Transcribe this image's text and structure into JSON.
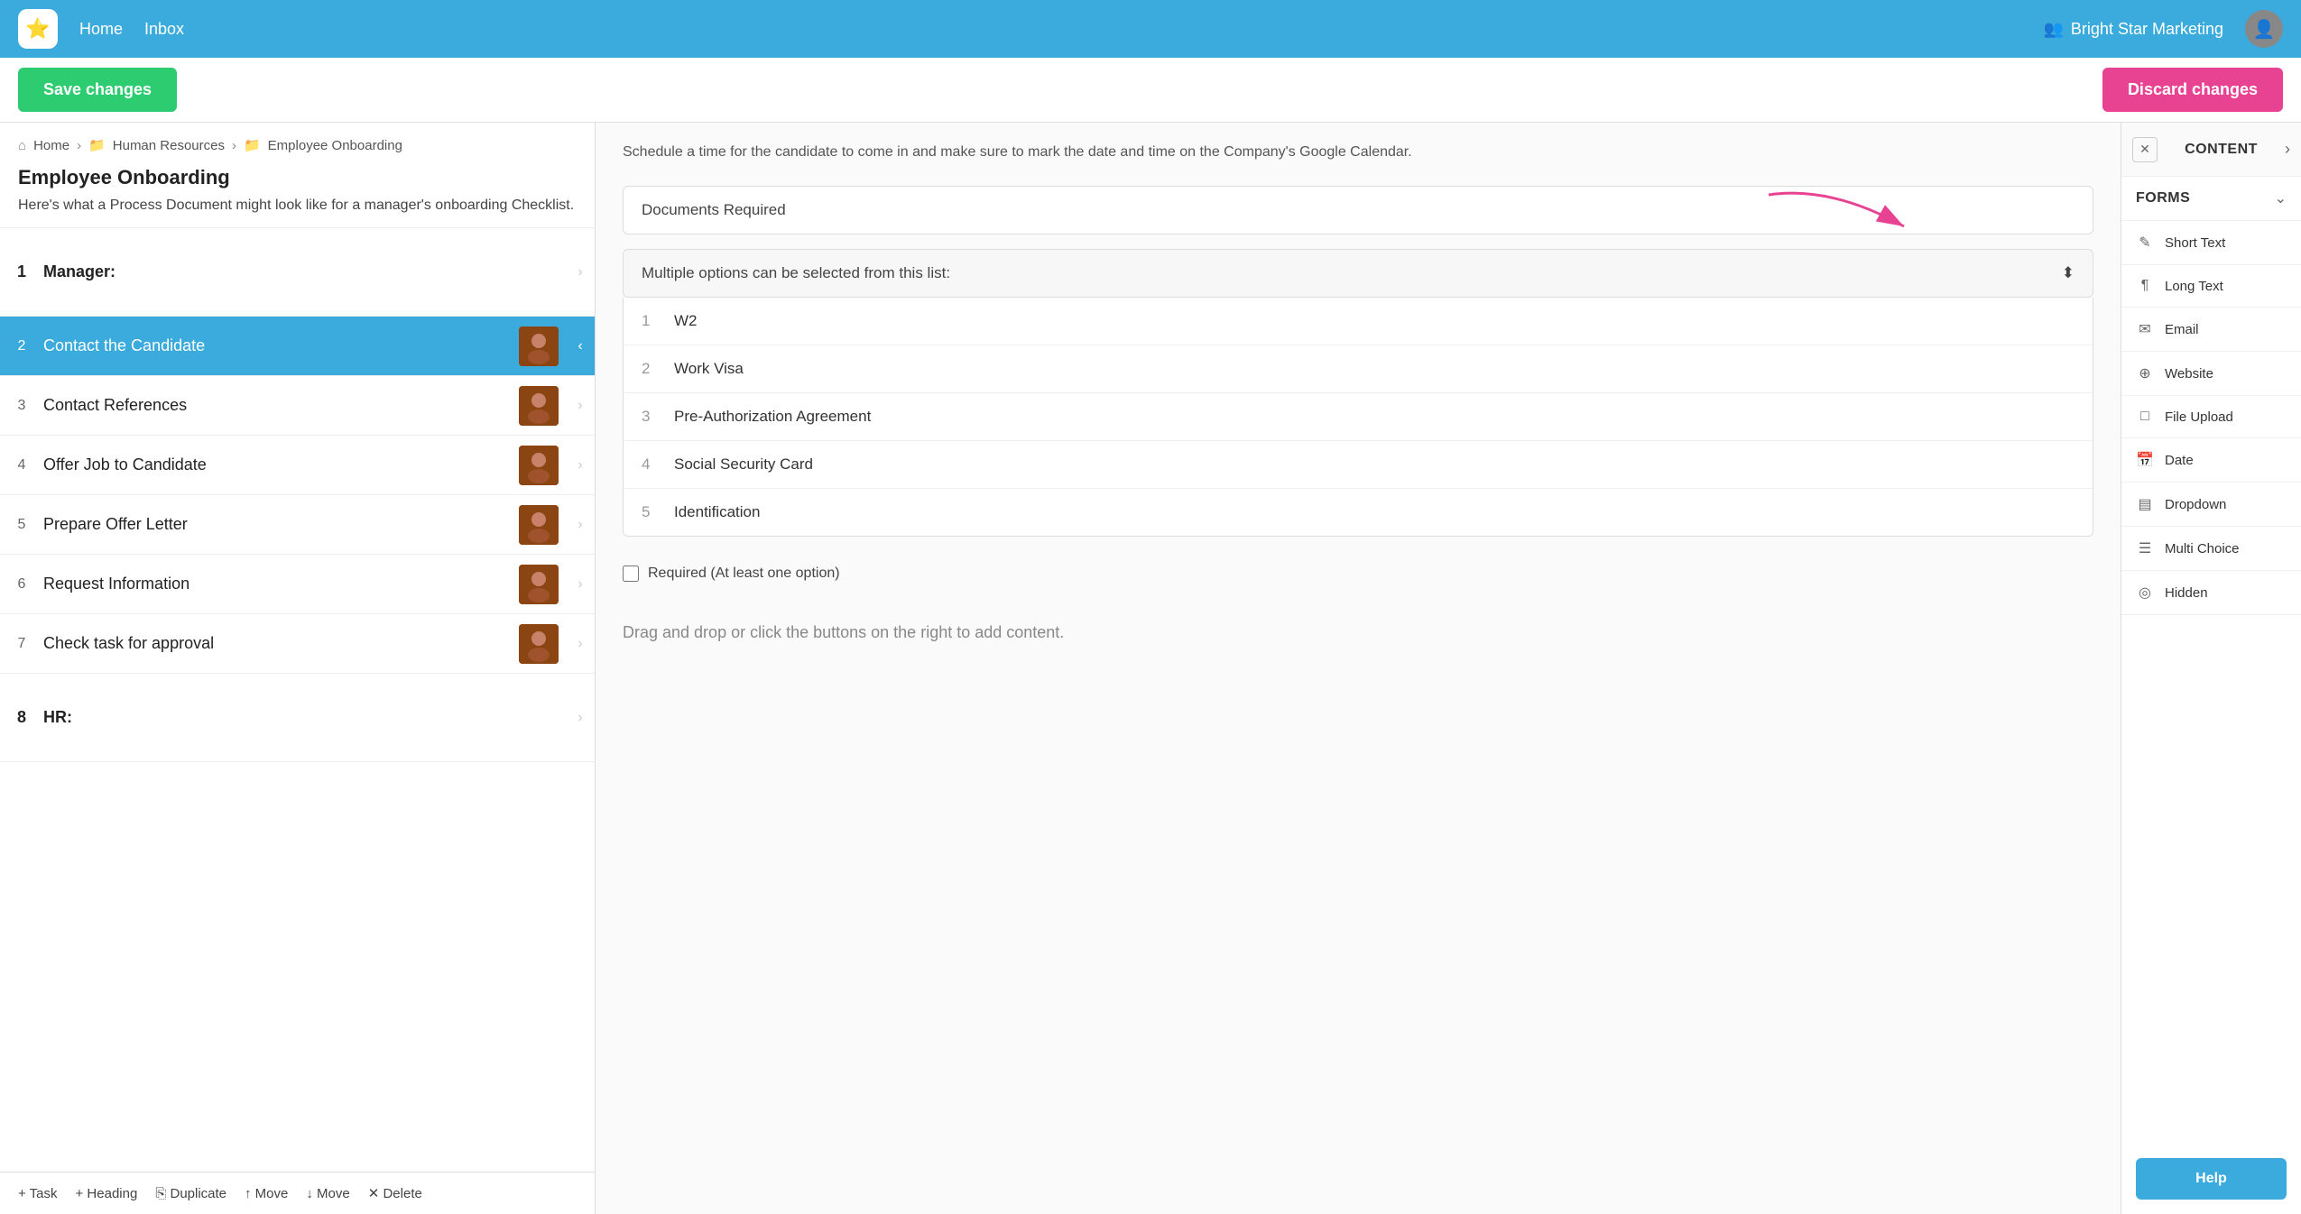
{
  "nav": {
    "logo": "⭐",
    "home_label": "Home",
    "inbox_label": "Inbox",
    "company_icon": "👥",
    "company_name": "Bright Star Marketing",
    "avatar_icon": "👤"
  },
  "action_bar": {
    "save_label": "Save changes",
    "discard_label": "Discard changes"
  },
  "breadcrumb": {
    "home": "Home",
    "folder1": "Human Resources",
    "folder2": "Employee Onboarding"
  },
  "document": {
    "title": "Employee Onboarding",
    "description": "Here's what a Process Document might look like for a manager's onboarding Checklist."
  },
  "sections": [
    {
      "number": "1",
      "label": "Manager:",
      "is_header": true
    },
    {
      "number": "2",
      "label": "Contact the Candidate",
      "active": true,
      "has_avatar": true
    },
    {
      "number": "3",
      "label": "Contact References",
      "has_avatar": true
    },
    {
      "number": "4",
      "label": "Offer Job to Candidate",
      "has_avatar": true
    },
    {
      "number": "5",
      "label": "Prepare Offer Letter",
      "has_avatar": true
    },
    {
      "number": "6",
      "label": "Request Information",
      "has_avatar": true
    },
    {
      "number": "7",
      "label": "Check task for approval",
      "has_avatar": true
    },
    {
      "number": "8",
      "label": "HR:",
      "is_header": true
    }
  ],
  "toolbar": {
    "task": "+ Task",
    "heading": "+ Heading",
    "duplicate": "⎘ Duplicate",
    "move_up": "↑ Move",
    "move_down": "↓ Move",
    "delete": "✕ Delete"
  },
  "content": {
    "intro_text": "Schedule a time for the candidate to come in and make sure to mark the date and time on the Company's Google Calendar.",
    "field_label": "Documents Required",
    "dropdown_text": "Multiple options can be selected from this list:",
    "options": [
      {
        "num": "1",
        "label": "W2"
      },
      {
        "num": "2",
        "label": "Work Visa"
      },
      {
        "num": "3",
        "label": "Pre-Authorization Agreement"
      },
      {
        "num": "4",
        "label": "Social Security Card"
      },
      {
        "num": "5",
        "label": "Identification"
      }
    ],
    "required_text": "Required (At least one option)",
    "drag_hint": "Drag and drop or click the buttons on the right to add content."
  },
  "right_panel": {
    "close_icon": "✕",
    "content_label": "CONTENT",
    "expand_icon": "›",
    "forms_label": "FORMS",
    "forms_chevron": "⌄",
    "items": [
      {
        "icon": "✎",
        "label": "Short Text"
      },
      {
        "icon": "¶",
        "label": "Long Text"
      },
      {
        "icon": "✉",
        "label": "Email"
      },
      {
        "icon": "⊕",
        "label": "Website"
      },
      {
        "icon": "□",
        "label": "File Upload"
      },
      {
        "icon": "📅",
        "label": "Date"
      },
      {
        "icon": "▤",
        "label": "Dropdown"
      },
      {
        "icon": "☰",
        "label": "Multi Choice"
      },
      {
        "icon": "◎",
        "label": "Hidden"
      }
    ],
    "help_label": "Help"
  }
}
